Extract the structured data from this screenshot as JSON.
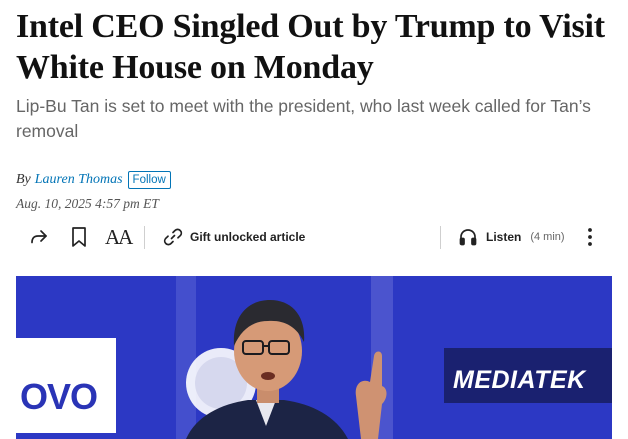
{
  "article": {
    "headline": "Intel CEO Singled Out by Trump to Visit White House on Monday",
    "dek": "Lip-Bu Tan is set to meet with the president, who last week called for Tan’s removal",
    "byline_prefix": "By",
    "author": "Lauren Thomas",
    "follow_label": "Follow",
    "date": "Aug. 10, 2025 4:57 pm ET"
  },
  "toolbar": {
    "share_icon": "share-arrow-icon",
    "bookmark_icon": "bookmark-icon",
    "text_size_label": "AA",
    "gift_label": "Gift unlocked article",
    "listen_label": "Listen",
    "listen_duration": "(4 min)",
    "more_icon": "more-vertical-icon"
  },
  "photo": {
    "logo_left_text": "OVO",
    "logo_right_text": "MEDIATEK"
  },
  "colors": {
    "link": "#0274b6",
    "photo_background": "#2f3bd0"
  }
}
